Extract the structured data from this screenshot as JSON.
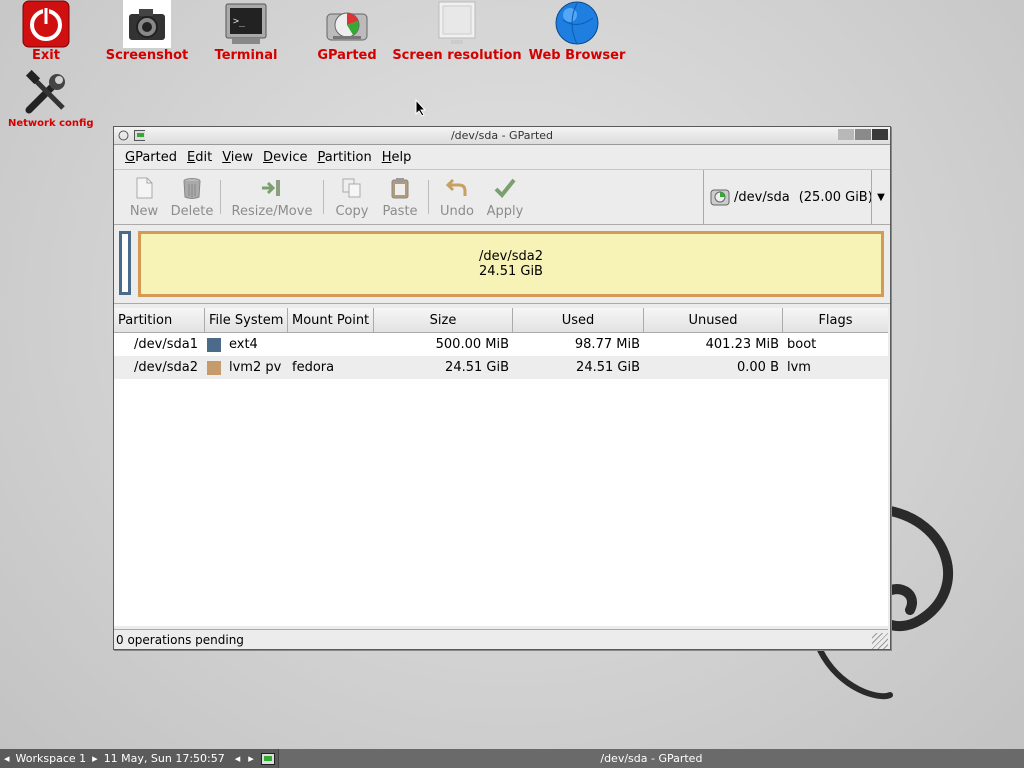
{
  "desktop": {
    "icons": [
      {
        "label": "Exit",
        "icon": "power-icon"
      },
      {
        "label": "Screenshot",
        "icon": "camera-icon"
      },
      {
        "label": "Terminal",
        "icon": "terminal-icon"
      },
      {
        "label": "GParted",
        "icon": "gparted-icon"
      },
      {
        "label": "Screen resolution",
        "icon": "monitor-icon"
      },
      {
        "label": "Web Browser",
        "icon": "globe-icon"
      },
      {
        "label": "Network config",
        "icon": "tools-icon"
      }
    ]
  },
  "window": {
    "title": "/dev/sda - GParted",
    "menu": [
      {
        "label": "GParted",
        "mnemonic": "G"
      },
      {
        "label": "Edit",
        "mnemonic": "E"
      },
      {
        "label": "View",
        "mnemonic": "V"
      },
      {
        "label": "Device",
        "mnemonic": "D"
      },
      {
        "label": "Partition",
        "mnemonic": "P"
      },
      {
        "label": "Help",
        "mnemonic": "H"
      }
    ],
    "toolbar": {
      "new": "New",
      "delete": "Delete",
      "resize": "Resize/Move",
      "copy": "Copy",
      "paste": "Paste",
      "undo": "Undo",
      "apply": "Apply"
    },
    "device_selector": {
      "device": "/dev/sda",
      "size": "(25.00 GiB)"
    },
    "graph": {
      "main_name": "/dev/sda2",
      "main_size": "24.51 GiB"
    },
    "table": {
      "headers": [
        "Partition",
        "File System",
        "Mount Point",
        "Size",
        "Used",
        "Unused",
        "Flags"
      ],
      "rows": [
        {
          "partition": "/dev/sda1",
          "fs": "ext4",
          "fs_color": "#4a6b8a",
          "mount": "",
          "size": "500.00 MiB",
          "used": "98.77 MiB",
          "unused": "401.23 MiB",
          "flags": "boot"
        },
        {
          "partition": "/dev/sda2",
          "fs": "lvm2 pv",
          "fs_color": "#c69b6b",
          "mount": "fedora",
          "size": "24.51 GiB",
          "used": "24.51 GiB",
          "unused": "0.00 B",
          "flags": "lvm"
        }
      ]
    },
    "status": "0 operations pending"
  },
  "taskbar": {
    "workspace": "Workspace 1",
    "clock": "11 May, Sun 17:50:57",
    "task": "/dev/sda - GParted"
  },
  "colors": {
    "accent_label": "#d40000",
    "partition_used": "#f7f3b6",
    "partition_border": "#d29a55"
  }
}
